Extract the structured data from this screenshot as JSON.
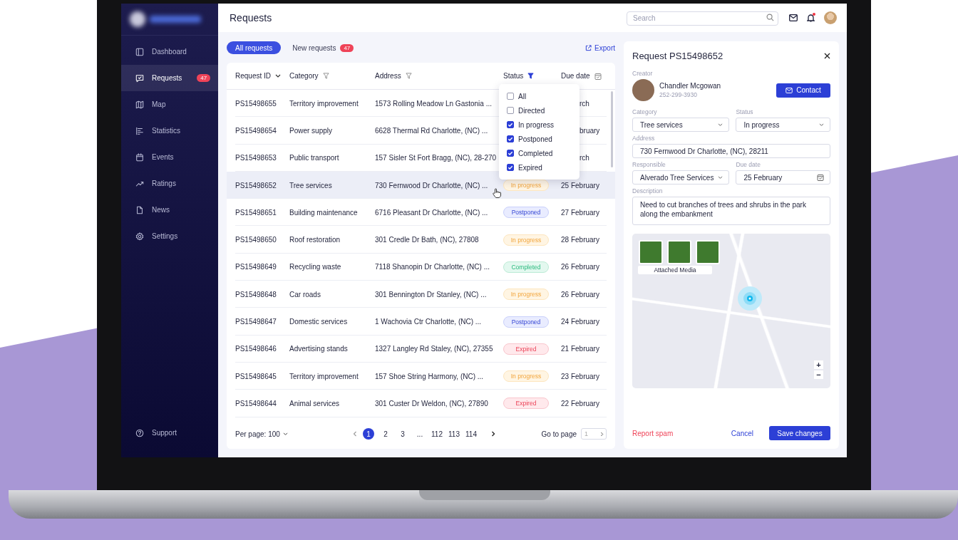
{
  "sidebar": {
    "items": [
      {
        "label": "Dashboard",
        "selected": false
      },
      {
        "label": "Requests",
        "badge": "47",
        "selected": true
      },
      {
        "label": "Map",
        "selected": false
      },
      {
        "label": "Statistics",
        "selected": false
      },
      {
        "label": "Events",
        "selected": false
      },
      {
        "label": "Ratings",
        "selected": false
      },
      {
        "label": "News",
        "selected": false
      },
      {
        "label": "Settings",
        "selected": false
      }
    ],
    "support": "Support"
  },
  "header": {
    "title": "Requests",
    "search": {
      "placeholder": "Search"
    },
    "unread_notifications": true
  },
  "tabs": [
    {
      "label": "All requests",
      "selected": true
    },
    {
      "label": "New requests",
      "badge": "47",
      "selected": false
    }
  ],
  "export": "Export",
  "table": {
    "columns": [
      {
        "label": "Request ID"
      },
      {
        "label": "Category"
      },
      {
        "label": "Address"
      },
      {
        "label": "Status"
      },
      {
        "label": "Due date"
      }
    ],
    "rows": [
      {
        "id": "PS15498655",
        "category": "Territory improvement",
        "address": "1573 Rolling Meadow Ln Gastonia ...",
        "due": "rch",
        "selected": false
      },
      {
        "id": "PS15498654",
        "category": "Power supply",
        "address": "6628 Thermal Rd Charlotte, (NC) ...",
        "due": "bruary",
        "selected": false
      },
      {
        "id": "PS15498653",
        "category": "Public transport",
        "address": "157 Sisler St Fort Bragg, (NC), 28-270",
        "due": "rch",
        "selected": false
      },
      {
        "id": "PS15498652",
        "category": "Tree services",
        "address": "730 Fernwood Dr Charlotte, (NC) ...",
        "status": {
          "label": "In progress",
          "kind": "progress"
        },
        "due": "25 February",
        "selected": true
      },
      {
        "id": "PS15498651",
        "category": "Building maintenance",
        "address": "6716 Pleasant Dr Charlotte, (NC) ...",
        "status": {
          "label": "Postponed",
          "kind": "postponed"
        },
        "due": "27 February",
        "selected": false
      },
      {
        "id": "PS15498650",
        "category": "Roof restoration",
        "address": "301 Credle Dr Bath, (NC), 27808",
        "status": {
          "label": "In progress",
          "kind": "progress"
        },
        "due": "28 February",
        "selected": false
      },
      {
        "id": "PS15498649",
        "category": "Recycling waste",
        "address": "7118 Shanopin Dr Charlotte, (NC) ...",
        "status": {
          "label": "Completed",
          "kind": "completed"
        },
        "due": "26 February",
        "selected": false
      },
      {
        "id": "PS15498648",
        "category": "Car roads",
        "address": "301 Bennington Dr Stanley, (NC) ...",
        "status": {
          "label": "In progress",
          "kind": "progress"
        },
        "due": "26 February",
        "selected": false
      },
      {
        "id": "PS15498647",
        "category": "Domestic services",
        "address": "1 Wachovia Ctr Charlotte, (NC) ...",
        "status": {
          "label": "Postponed",
          "kind": "postponed"
        },
        "due": "24 February",
        "selected": false
      },
      {
        "id": "PS15498646",
        "category": "Advertising stands",
        "address": "1327 Langley Rd Staley, (NC), 27355",
        "status": {
          "label": "Expired",
          "kind": "expired"
        },
        "due": "21 February",
        "selected": false
      },
      {
        "id": "PS15498645",
        "category": "Territory improvement",
        "address": "157 Shoe String Harmony, (NC) ...",
        "status": {
          "label": "In progress",
          "kind": "progress"
        },
        "due": "23 February",
        "selected": false
      },
      {
        "id": "PS15498644",
        "category": "Animal services",
        "address": "301 Custer Dr Weldon, (NC), 27890",
        "status": {
          "label": "Expired",
          "kind": "expired"
        },
        "due": "22 February",
        "selected": false
      }
    ]
  },
  "status_filter": {
    "options": [
      {
        "label": "All",
        "checked": false
      },
      {
        "label": "Directed",
        "checked": false
      },
      {
        "label": "In progress",
        "checked": true
      },
      {
        "label": "Postponed",
        "checked": true
      },
      {
        "label": "Completed",
        "checked": true
      },
      {
        "label": "Expired",
        "checked": true
      }
    ]
  },
  "pagination": {
    "per_page": "Per page: 100",
    "pages": [
      {
        "label": "1",
        "selected": true
      },
      {
        "label": "2",
        "selected": false
      },
      {
        "label": "3",
        "selected": false
      },
      {
        "label": "...",
        "selected": false
      },
      {
        "label": "112",
        "selected": false
      },
      {
        "label": "113",
        "selected": false
      },
      {
        "label": "114",
        "selected": false
      }
    ],
    "go_to": "Go to page",
    "go_placeholder": "1"
  },
  "panel": {
    "title": "Request PS15498652",
    "creator_label": "Creator",
    "creator_name": "Chandler Mcgowan",
    "creator_phone": "252-299-3930",
    "contact": "Contact",
    "fields": [
      {
        "label": "Category",
        "value": "Tree services",
        "kind": "select"
      },
      {
        "label": "Status",
        "value": "In progress",
        "kind": "select"
      },
      {
        "label": "Address",
        "value": "730 Fernwood Dr Charlotte, (NC), 28211",
        "kind": "text"
      },
      {
        "label": "Responsible",
        "value": "Alverado Tree Services",
        "kind": "select"
      },
      {
        "label": "Due date",
        "value": "25 February",
        "kind": "date"
      },
      {
        "label": "Description",
        "value": "Need to cut branches of trees and shrubs in the park along the embankment",
        "kind": "textarea"
      }
    ],
    "media_label": "Attached Media",
    "zoom_in": "+",
    "zoom_out": "−",
    "report": "Report spam",
    "cancel": "Cancel",
    "save": "Save changes"
  }
}
